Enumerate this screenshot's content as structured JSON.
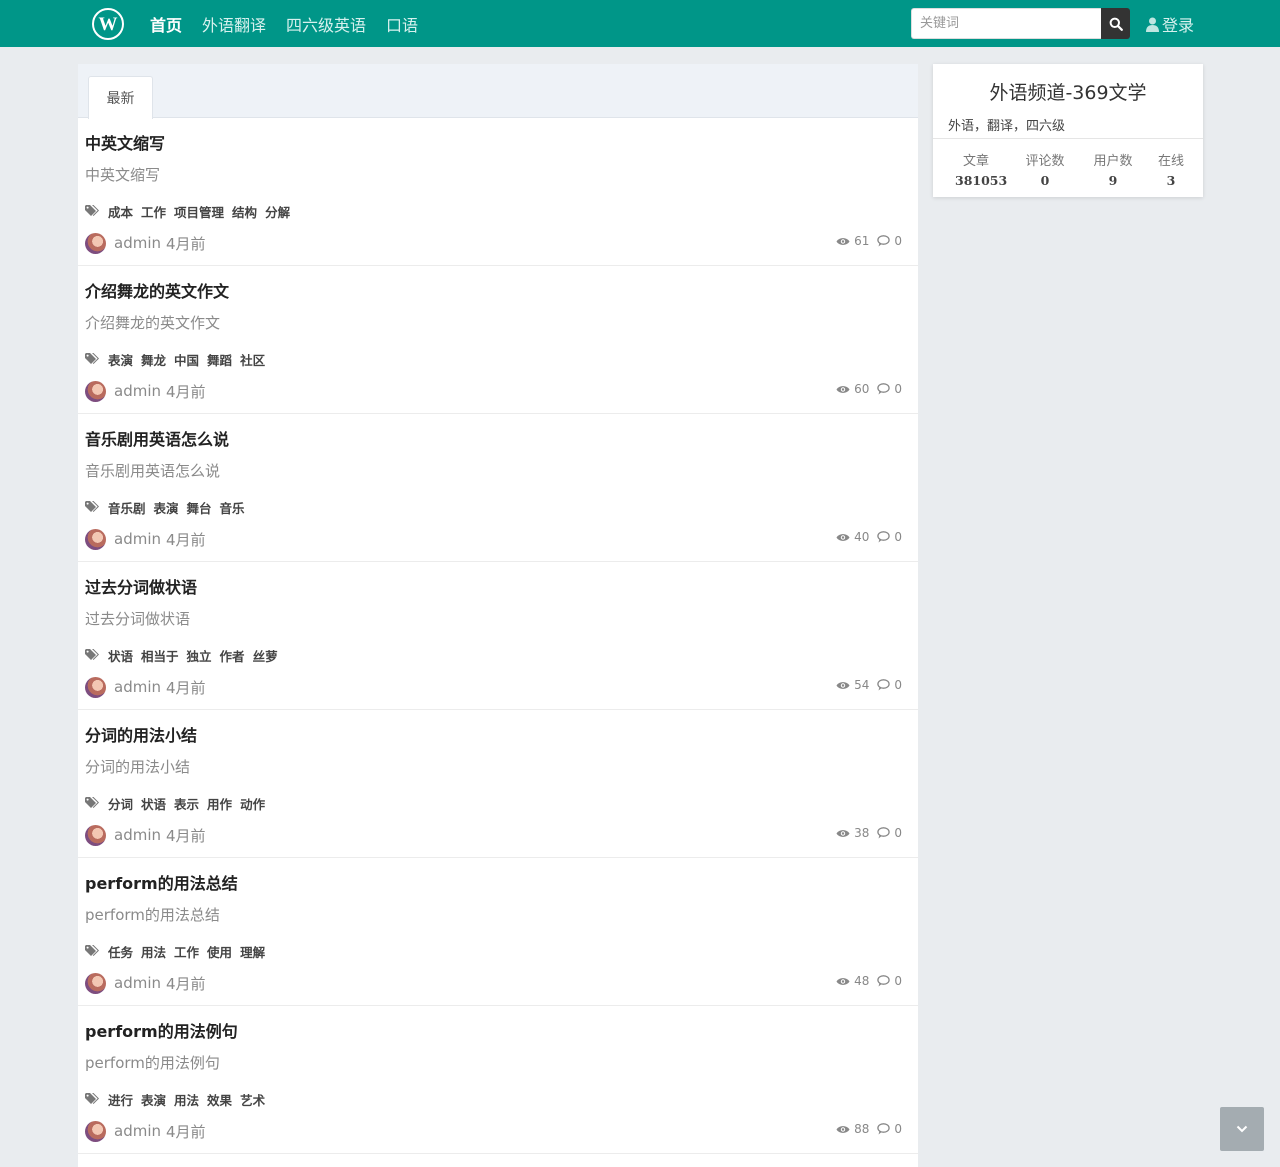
{
  "nav": {
    "logo_letter": "W",
    "links": [
      {
        "label": "首页",
        "active": true
      },
      {
        "label": "外语翻译",
        "active": false
      },
      {
        "label": "四六级英语",
        "active": false
      },
      {
        "label": "口语",
        "active": false
      }
    ],
    "search_placeholder": "关键词",
    "login_label": "登录"
  },
  "tab": {
    "label": "最新"
  },
  "articles": [
    {
      "title": "中英文缩写",
      "summary": "中英文缩写",
      "tags": [
        "成本",
        "工作",
        "项目管理",
        "结构",
        "分解"
      ],
      "author": "admin",
      "time": "4月前",
      "views": "61",
      "comments": "0"
    },
    {
      "title": "介绍舞龙的英文作文",
      "summary": "介绍舞龙的英文作文",
      "tags": [
        "表演",
        "舞龙",
        "中国",
        "舞蹈",
        "社区"
      ],
      "author": "admin",
      "time": "4月前",
      "views": "60",
      "comments": "0"
    },
    {
      "title": "音乐剧用英语怎么说",
      "summary": "音乐剧用英语怎么说",
      "tags": [
        "音乐剧",
        "表演",
        "舞台",
        "音乐"
      ],
      "author": "admin",
      "time": "4月前",
      "views": "40",
      "comments": "0"
    },
    {
      "title": "过去分词做状语",
      "summary": "过去分词做状语",
      "tags": [
        "状语",
        "相当于",
        "独立",
        "作者",
        "丝萝"
      ],
      "author": "admin",
      "time": "4月前",
      "views": "54",
      "comments": "0"
    },
    {
      "title": "分词的用法小结",
      "summary": "分词的用法小结",
      "tags": [
        "分词",
        "状语",
        "表示",
        "用作",
        "动作"
      ],
      "author": "admin",
      "time": "4月前",
      "views": "38",
      "comments": "0"
    },
    {
      "title": "perform的用法总结",
      "summary": "perform的用法总结",
      "tags": [
        "任务",
        "用法",
        "工作",
        "使用",
        "理解"
      ],
      "author": "admin",
      "time": "4月前",
      "views": "48",
      "comments": "0"
    },
    {
      "title": "perform的用法例句",
      "summary": "perform的用法例句",
      "tags": [
        "进行",
        "表演",
        "用法",
        "效果",
        "艺术"
      ],
      "author": "admin",
      "time": "4月前",
      "views": "88",
      "comments": "0"
    }
  ],
  "sidebar": {
    "title": "外语频道-369文学",
    "description": "外语，翻译，四六级",
    "stats": [
      {
        "label": "文章",
        "value": "381053"
      },
      {
        "label": "评论数",
        "value": "0"
      },
      {
        "label": "用户数",
        "value": "9"
      },
      {
        "label": "在线",
        "value": "3"
      }
    ]
  },
  "icons": {
    "search": "search-icon",
    "user": "user-icon",
    "tags": "tags-icon",
    "eye": "eye-icon",
    "comment": "comment-icon",
    "scroll": "chevron-down-icon"
  },
  "colors": {
    "brand": "#009688",
    "background": "#e9ecef"
  }
}
